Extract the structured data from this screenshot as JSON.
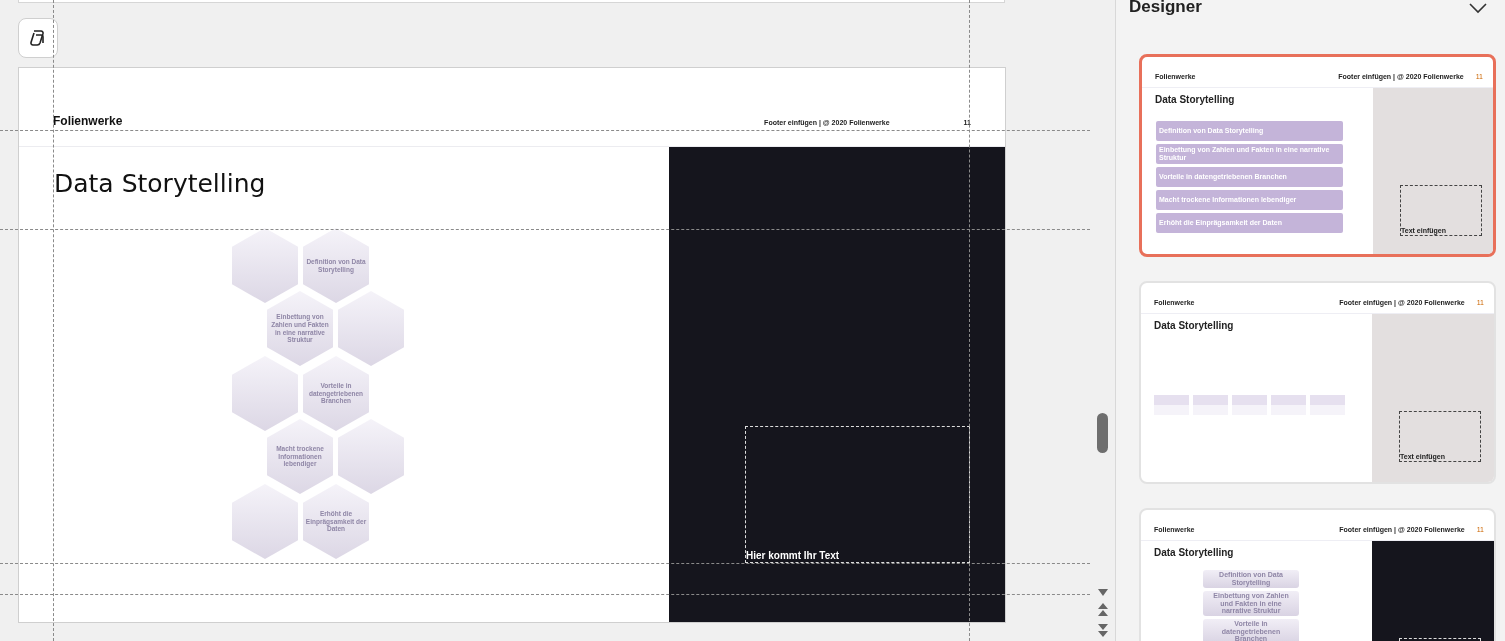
{
  "slide": {
    "brand": "Folienwerke",
    "footer": "Footer einfügen | @ 2020 Folienwerke",
    "number": "11",
    "title": "Data Storytelling",
    "hexagons": [
      {
        "kind": "blank"
      },
      {
        "kind": "label",
        "text": "Definition von Data Storytelling"
      },
      {
        "kind": "label",
        "text": "Einbettung von Zahlen und Fakten in eine narrative Struktur"
      },
      {
        "kind": "blank"
      },
      {
        "kind": "blank"
      },
      {
        "kind": "label",
        "text": "Vorteile in datengetriebenen Branchen"
      },
      {
        "kind": "label",
        "text": "Macht trockene Informationen lebendiger"
      },
      {
        "kind": "blank"
      },
      {
        "kind": "blank"
      },
      {
        "kind": "label",
        "text": "Erhöht die Einprägsamkeit der Daten"
      }
    ],
    "text_placeholder": "Hier kommt Ihr Text"
  },
  "designer": {
    "title": "Designer",
    "designs": [
      {
        "selected": true,
        "kind": "list",
        "color": "#e3dfdf",
        "brand": "Folienwerke",
        "footer": "Footer einfügen | @ 2020 Folienwerke",
        "number": "11",
        "placeholder": "Text einfügen",
        "title": "Data Storytelling",
        "items": [
          "Definition von Data Storytelling",
          "Einbettung von Zahlen und Fakten in eine narrative Struktur",
          "Vorteile in datengetriebenen Branchen",
          "Macht trockene Informationen lebendiger",
          "Erhöht die Einprägsamkeit der Daten"
        ]
      },
      {
        "selected": false,
        "kind": "row",
        "color": "#e3dfdf",
        "brand": "Folienwerke",
        "footer": "Footer einfügen | @ 2020 Folienwerke",
        "number": "11",
        "placeholder": "Text einfügen",
        "title": "Data Storytelling",
        "tiles": [
          {
            "kind": "tile"
          },
          {
            "kind": "tile"
          },
          {
            "kind": "tile"
          },
          {
            "kind": "tile"
          },
          {
            "kind": "tile"
          }
        ]
      },
      {
        "selected": false,
        "kind": "stack",
        "color": "#15151d",
        "brand": "Folienwerke",
        "footer": "Footer einfügen | @ 2020 Folienwerke",
        "number": "11",
        "title": "Data Storytelling",
        "items": [
          "Definition von Data Storytelling",
          "Einbettung von Zahlen und Fakten in eine narrative Struktur",
          "Vorteile in datengetriebenen Branchen"
        ]
      }
    ]
  }
}
